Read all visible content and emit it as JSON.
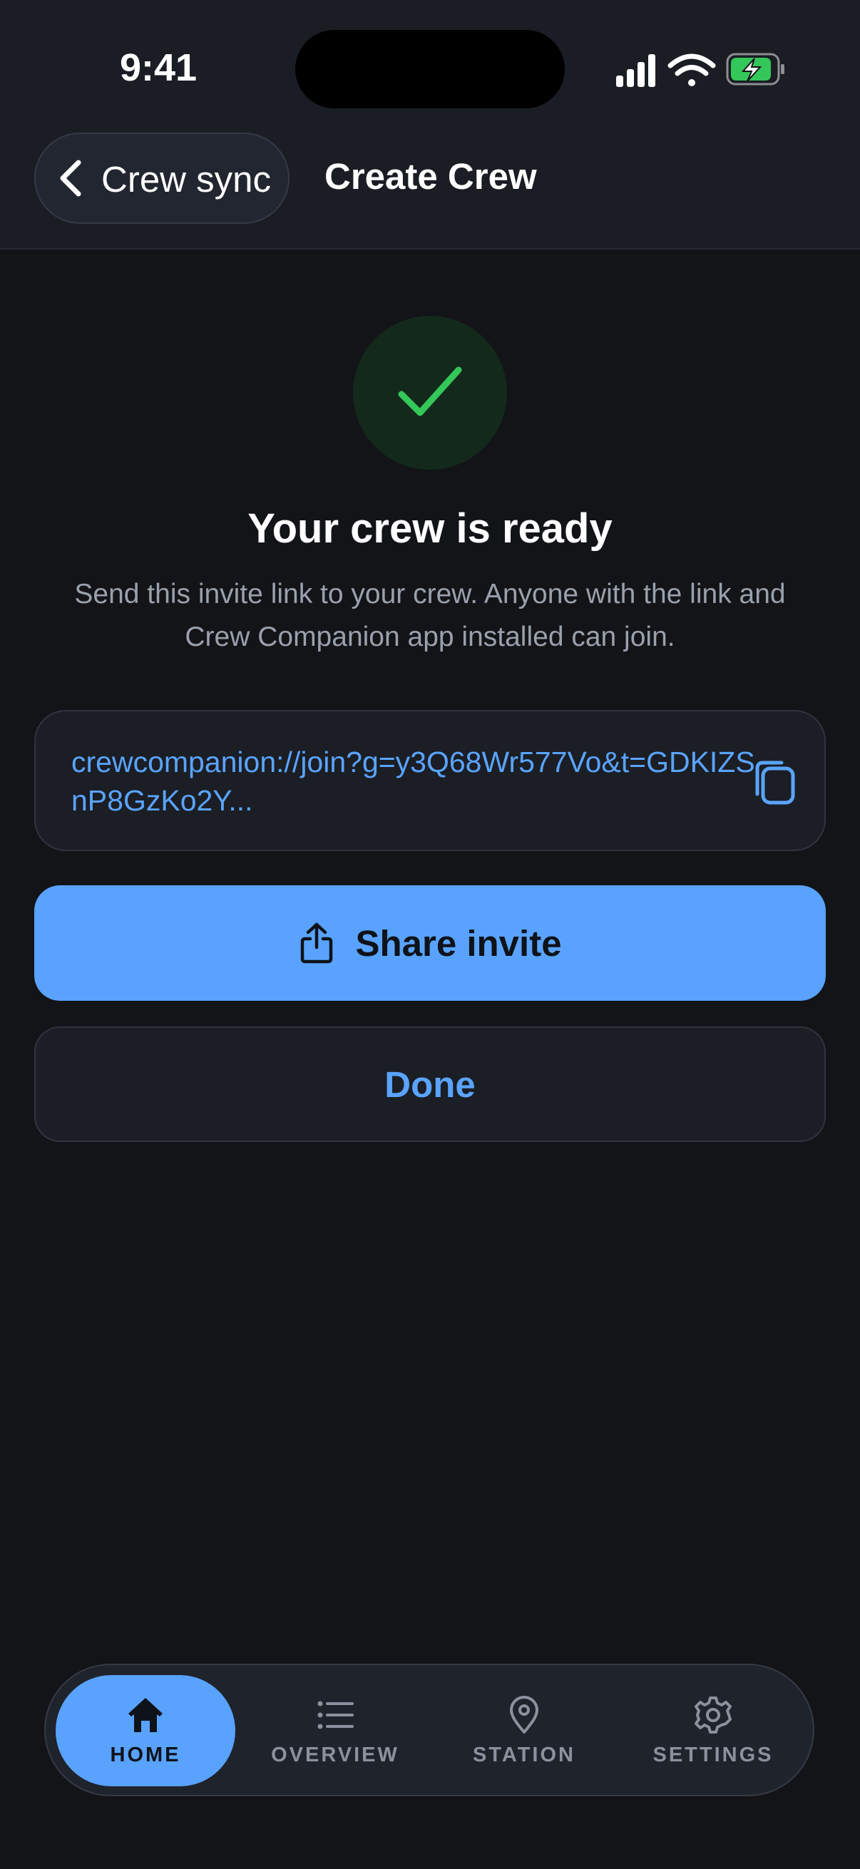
{
  "status_bar": {
    "time": "9:41",
    "icons": [
      "signal-icon",
      "wifi-icon",
      "battery-charging-icon"
    ]
  },
  "nav": {
    "back_label": "Crew sync",
    "title": "Create Crew"
  },
  "main": {
    "success_icon": "checkmark-icon",
    "title": "Your crew is ready",
    "subtitle": "Send this invite link to your crew. Anyone with the link and Crew Companion app installed can join.",
    "invite_link": "crewcompanion://join?g=y3Q68Wr577Vo&t=GDKIZSnP8GzKo2Y...",
    "share_label": "Share invite",
    "done_label": "Done"
  },
  "tabbar": {
    "tabs": [
      {
        "label": "HOME",
        "icon": "home-icon",
        "active": true
      },
      {
        "label": "OVERVIEW",
        "icon": "list-icon",
        "active": false
      },
      {
        "label": "STATION",
        "icon": "location-pin-icon",
        "active": false
      },
      {
        "label": "SETTINGS",
        "icon": "gear-icon",
        "active": false
      }
    ]
  },
  "colors": {
    "background": "#121418",
    "accent": "#59a3ff",
    "success": "#34c759",
    "link": "#5aa4ff"
  }
}
